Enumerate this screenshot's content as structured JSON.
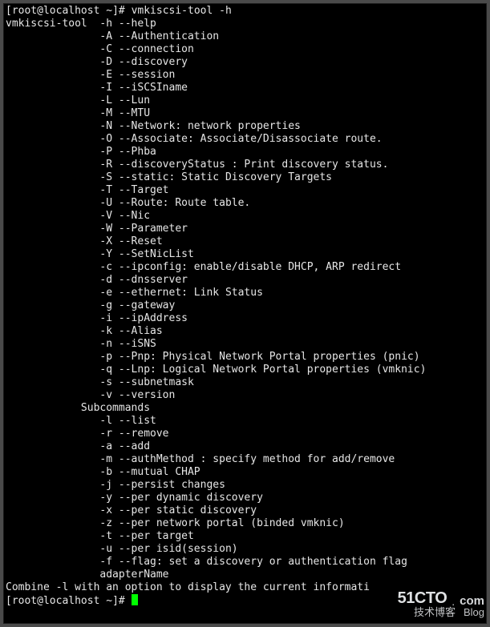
{
  "prompt1": {
    "user": "root",
    "host": "localhost",
    "dir": "~",
    "symbol": "#",
    "command": "vmkiscsi-tool -h"
  },
  "program": "vmkiscsi-tool",
  "options": [
    {
      "flag": "-h",
      "long": "--help"
    },
    {
      "flag": "-A",
      "long": "--Authentication"
    },
    {
      "flag": "-C",
      "long": "--connection"
    },
    {
      "flag": "-D",
      "long": "--discovery"
    },
    {
      "flag": "-E",
      "long": "--session"
    },
    {
      "flag": "-I",
      "long": "--iSCSIname"
    },
    {
      "flag": "-L",
      "long": "--Lun"
    },
    {
      "flag": "-M",
      "long": "--MTU"
    },
    {
      "flag": "-N",
      "long": "--Network: network properties"
    },
    {
      "flag": "-O",
      "long": "--Associate: Associate/Disassociate route."
    },
    {
      "flag": "-P",
      "long": "--Phba"
    },
    {
      "flag": "-R",
      "long": "--discoveryStatus : Print discovery status."
    },
    {
      "flag": "-S",
      "long": "--static: Static Discovery Targets"
    },
    {
      "flag": "-T",
      "long": "--Target"
    },
    {
      "flag": "-U",
      "long": "--Route: Route table."
    },
    {
      "flag": "-V",
      "long": "--Nic"
    },
    {
      "flag": "-W",
      "long": "--Parameter"
    },
    {
      "flag": "-X",
      "long": "--Reset"
    },
    {
      "flag": "-Y",
      "long": "--SetNicList"
    },
    {
      "flag": "-c",
      "long": "--ipconfig: enable/disable DHCP, ARP redirect"
    },
    {
      "flag": "-d",
      "long": "--dnsserver"
    },
    {
      "flag": "-e",
      "long": "--ethernet: Link Status"
    },
    {
      "flag": "-g",
      "long": "--gateway"
    },
    {
      "flag": "-i",
      "long": "--ipAddress"
    },
    {
      "flag": "-k",
      "long": "--Alias"
    },
    {
      "flag": "-n",
      "long": "--iSNS"
    },
    {
      "flag": "-p",
      "long": "--Pnp: Physical Network Portal properties (pnic)"
    },
    {
      "flag": "-q",
      "long": "--Lnp: Logical Network Portal properties (vmknic)"
    },
    {
      "flag": "-s",
      "long": "--subnetmask"
    },
    {
      "flag": "-v",
      "long": "--version"
    }
  ],
  "subcommands_label": "Subcommands",
  "subcommands": [
    {
      "flag": "-l",
      "long": "--list"
    },
    {
      "flag": "-r",
      "long": "--remove"
    },
    {
      "flag": "-a",
      "long": "--add"
    },
    {
      "flag": "-m",
      "long": "--authMethod : specify method for add/remove"
    },
    {
      "flag": "-b",
      "long": "--mutual CHAP"
    },
    {
      "flag": "-j",
      "long": "--persist changes"
    },
    {
      "flag": "-y",
      "long": "--per dynamic discovery"
    },
    {
      "flag": "-x",
      "long": "--per static discovery"
    },
    {
      "flag": "-z",
      "long": "--per network portal (binded vmknic)"
    },
    {
      "flag": "-t",
      "long": "--per target"
    },
    {
      "flag": "-u",
      "long": "--per isid(session)"
    },
    {
      "flag": "-f",
      "long": "--flag: set a discovery or authentication flag"
    }
  ],
  "adapter_label": "adapterName",
  "bottom_line": "Combine -l with an option to display the current informati",
  "prompt2": {
    "user": "root",
    "host": "localhost",
    "dir": "~",
    "symbol": "#"
  },
  "watermark": {
    "site": "51CTO",
    "dot": ".",
    "tld": "com",
    "chinese": "技术博客",
    "tag": "Blog"
  }
}
